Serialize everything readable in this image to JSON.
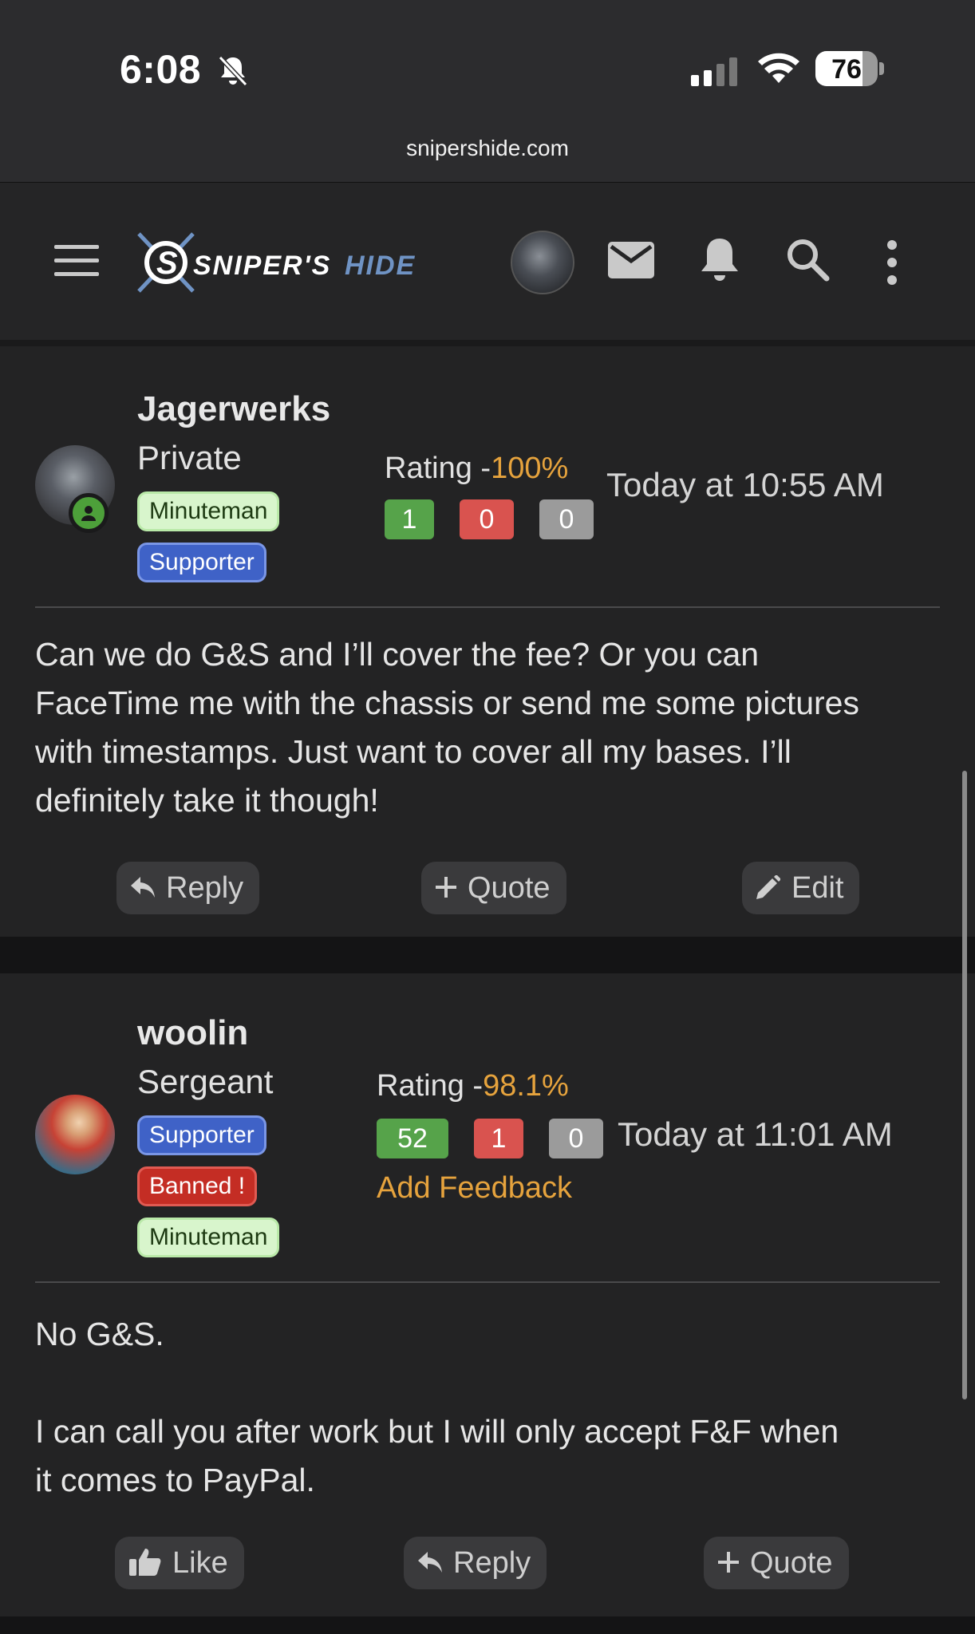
{
  "status_bar": {
    "time": "6:08",
    "battery": "76",
    "battery_level": 0.76
  },
  "browser": {
    "url": "snipershide.com"
  },
  "header": {
    "logo_alt": "SNIPER'S HIDE",
    "icons": [
      "menu-icon",
      "avatar",
      "mail-icon",
      "bell-icon",
      "search-icon",
      "more-vertical-icon"
    ]
  },
  "posts": [
    {
      "username": "Jagerwerks",
      "rank": "Private",
      "badges": [
        "Minuteman",
        "Supporter"
      ],
      "rating_label": "Rating -",
      "rating_pct": "100%",
      "scores": [
        "1",
        "0",
        "0"
      ],
      "timestamp": "Today at 10:55 AM",
      "body": [
        "Can we do G&S and I’ll cover the fee? Or you can",
        "FaceTime me with the chassis or send me some pictures",
        "with timestamps. Just want to cover all my bases. I’ll",
        "definitely take it though!"
      ],
      "actions": [
        "Reply",
        "Quote",
        "Edit"
      ]
    },
    {
      "username": "woolin",
      "rank": "Sergeant",
      "badges": [
        "Supporter",
        "Banned !",
        "Minuteman"
      ],
      "rating_label": "Rating -",
      "rating_pct": "98.1%",
      "scores": [
        "52",
        "1",
        "0"
      ],
      "timestamp": "Today at 11:01 AM",
      "add_feedback": "Add Feedback",
      "body": [
        "No G&S.",
        "",
        "I can call you after work but I will only accept F&F when",
        "it comes to PayPal."
      ],
      "actions": [
        "Like",
        "Reply",
        "Quote"
      ]
    }
  ],
  "colors": {
    "accent": "#e6a33d",
    "positive": "#56a34a",
    "negative": "#d9534f",
    "neutral": "#9b9b9b"
  }
}
